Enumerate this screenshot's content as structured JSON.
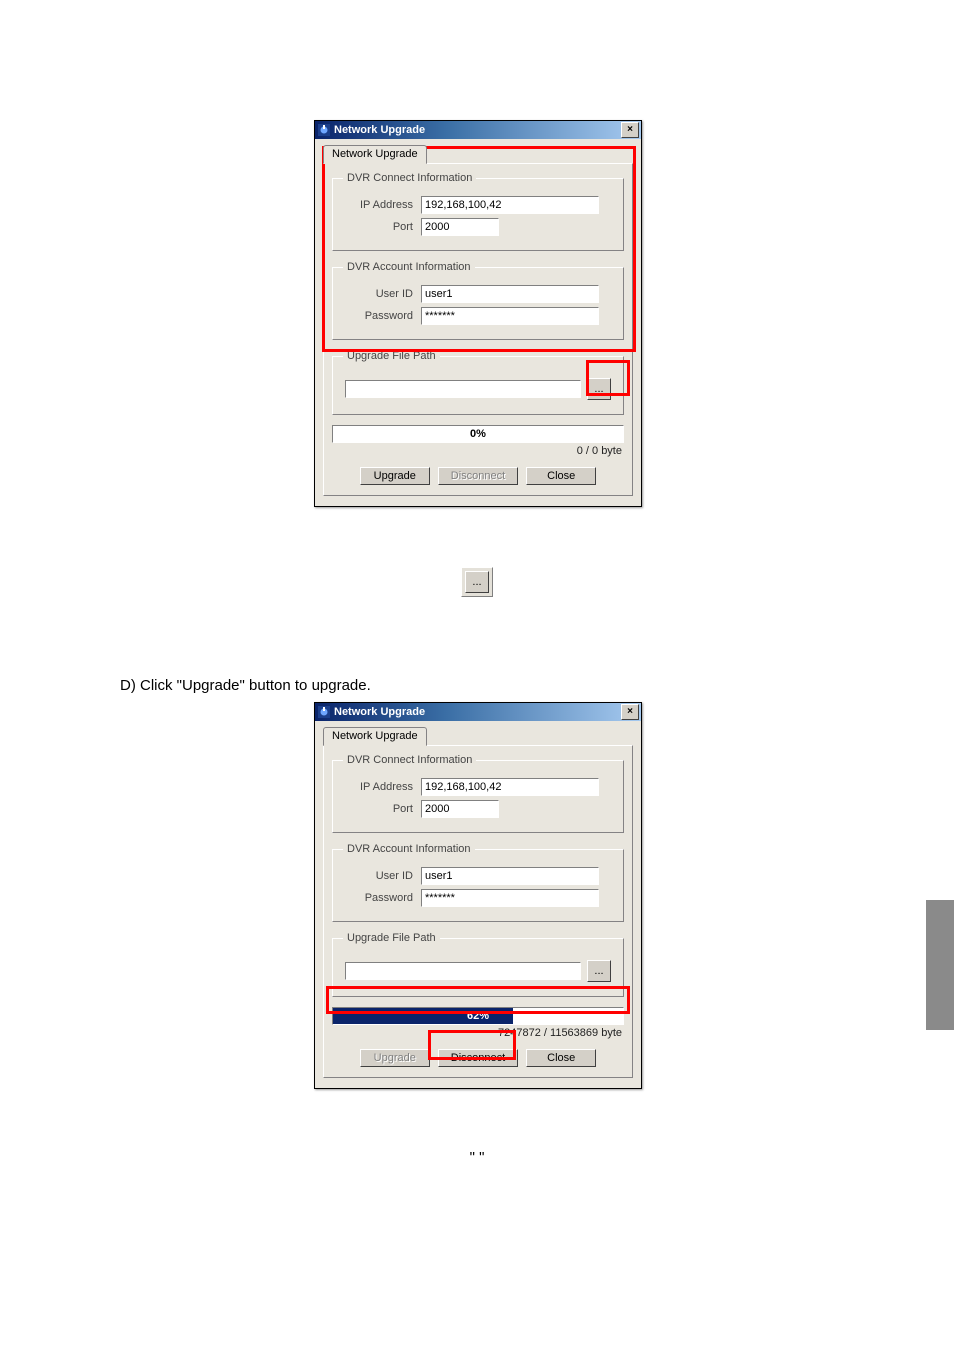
{
  "dialog1": {
    "title": "Network Upgrade",
    "tab_label": "Network Upgrade",
    "group_connect": "DVR Connect Information",
    "label_ip": "IP Address",
    "value_ip": "192,168,100,42",
    "label_port": "Port",
    "value_port": "2000",
    "group_account": "DVR Account Information",
    "label_user": "User ID",
    "value_user": "user1",
    "label_pw": "Password",
    "value_pw": "*******",
    "group_file": "Upgrade File Path",
    "value_file": "",
    "browse_label": "...",
    "progress_label": "0%",
    "progress_pct": 0,
    "bytes": "0 / 0 byte",
    "btn_upgrade": "Upgrade",
    "btn_disconnect": "Disconnect",
    "btn_close": "Close",
    "close_x": "×"
  },
  "standalone": {
    "browse_label": "..."
  },
  "instruction_d": "D) Click \"Upgrade\" button to upgrade.",
  "dialog2": {
    "title": "Network Upgrade",
    "tab_label": "Network Upgrade",
    "group_connect": "DVR Connect Information",
    "label_ip": "IP Address",
    "value_ip": "192,168,100,42",
    "label_port": "Port",
    "value_port": "2000",
    "group_account": "DVR Account Information",
    "label_user": "User ID",
    "value_user": "user1",
    "label_pw": "Password",
    "value_pw": "*******",
    "group_file": "Upgrade File Path",
    "value_file": "",
    "browse_label": "...",
    "progress_label": "62%",
    "progress_pct": 62,
    "bytes": "7247872 / 11563869 byte",
    "btn_upgrade": "Upgrade",
    "btn_disconnect": "Disconnect",
    "btn_close": "Close",
    "close_x": "×"
  },
  "footnote_quotes": "\"                                         \""
}
